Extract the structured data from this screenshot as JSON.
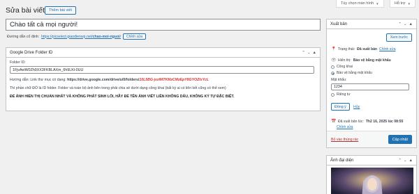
{
  "top_tabs": {
    "screen_options": "Tùy chọn màn hình",
    "help": "Hỗ trợ"
  },
  "header": {
    "title": "Sửa bài viết",
    "add_new": "Thêm bài viết"
  },
  "post": {
    "title": "Chào tất cả mọi người!",
    "permalink_label": "Đường dẫn cố định:",
    "permalink_base": "https://picselect.giaodienwp.net/",
    "permalink_slug": "chao-moi-nguoi",
    "permalink_end": "/",
    "edit_label": "Chỉnh sửa"
  },
  "gdrive": {
    "title": "Google Drive Folder ID",
    "field_label": "Folder ID:",
    "field_value": "1FjvAeiW0Zh9XX3FKBLAXm_6h9LKl-0UU",
    "help_prefix": "Hướng dẫn: Link thư mục có dạng: ",
    "help_url": "https://drive.google.com/drive/u/0/folders/",
    "help_id": "10L5BG-jvzlM7KMzCMzEpY8GYOZIsYcL",
    "note": "Thì phần chữ ĐỎ là ID folder. Folder và toàn bộ ảnh bên trong phải chia sẻ dưới dạng công khai (bất kỳ ai có liên kết cũng có thể xem)",
    "warning": "ĐỂ ẢNH HIỂN THỊ CHUẨN NHẤT VÀ KHÔNG PHÁT SINH LỖI, HÃY ĐỂ TÊN ẢNH VIẾT LIỀN KHÔNG DẤU, KHÔNG KÝ TỰ ĐẶC BIỆT."
  },
  "publish": {
    "title": "Xuất bản",
    "preview": "Xem trước",
    "status_label": "Trạng thái:",
    "status_value": "Đã xuất bản",
    "status_edit": "Chỉnh sửa",
    "visibility_label": "Hiển thị:",
    "visibility_value": "Bảo vệ bằng mật khẩu",
    "opt_public": "Công khai",
    "opt_password": "Bảo vệ bằng mật khẩu",
    "password_label": "Mật khẩu:",
    "password_value": "1234",
    "opt_private": "Riêng tư",
    "ok": "Đồng ý",
    "cancel": "Hủy",
    "published_on": "Đã xuất bản lúc:",
    "published_date": "Th2 16, 2025 lúc 08:55",
    "date_edit": "Chỉnh sửa",
    "trash": "Bỏ vào thùng rác",
    "update": "Cập nhật"
  },
  "featured": {
    "title": "Ảnh đại diện"
  },
  "colors": {
    "accent": "#2271b1",
    "danger": "#d63638",
    "background": "#f0f0f1"
  }
}
